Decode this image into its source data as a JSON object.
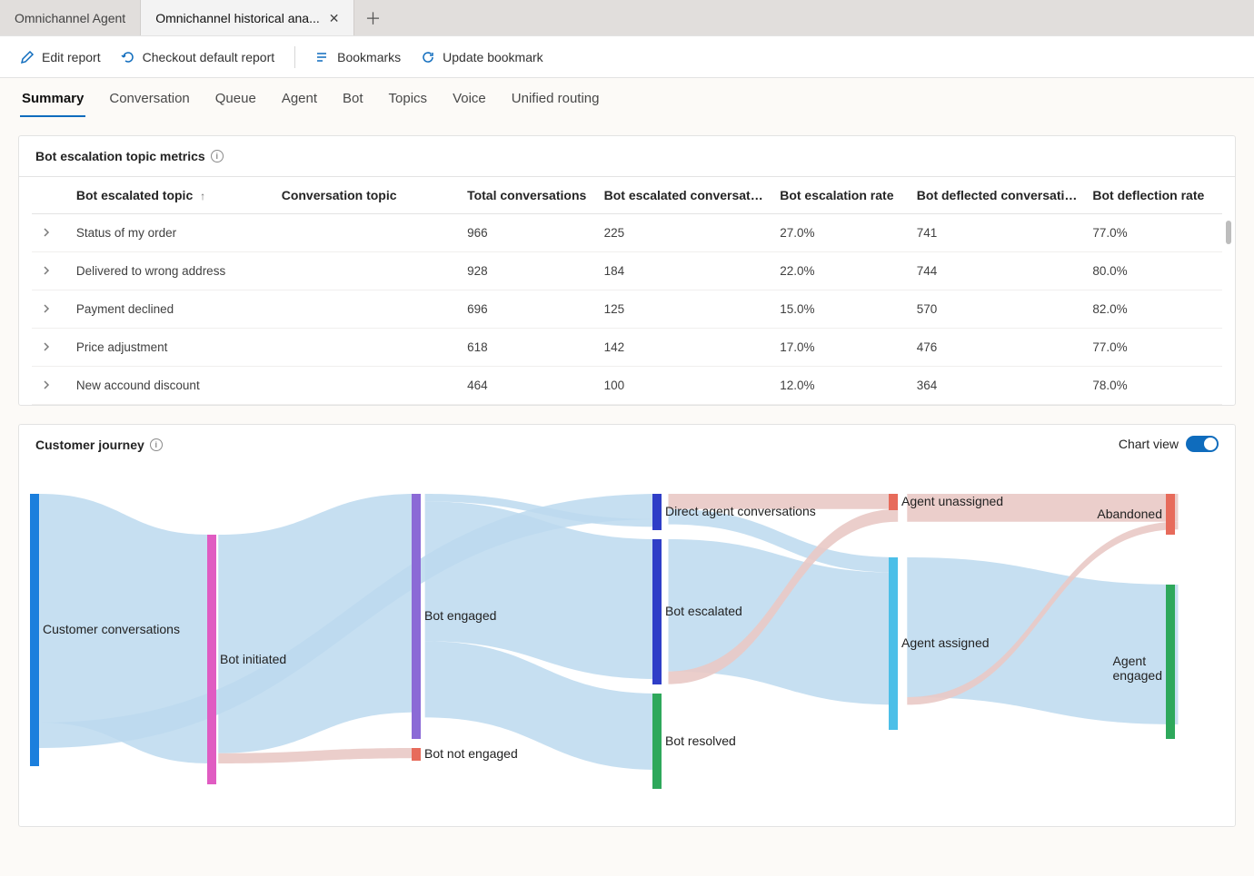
{
  "window_tabs": [
    {
      "label": "Omnichannel Agent",
      "active": false,
      "closable": false
    },
    {
      "label": "Omnichannel historical ana...",
      "active": true,
      "closable": true
    }
  ],
  "toolbar": {
    "edit": "Edit report",
    "checkout": "Checkout default report",
    "bookmarks": "Bookmarks",
    "update": "Update bookmark"
  },
  "report_tabs": [
    "Summary",
    "Conversation",
    "Queue",
    "Agent",
    "Bot",
    "Topics",
    "Voice",
    "Unified routing"
  ],
  "active_report_tab": "Summary",
  "metrics_panel": {
    "title": "Bot escalation topic metrics",
    "columns": [
      "Bot escalated topic",
      "Conversation topic",
      "Total conversations",
      "Bot escalated conversations",
      "Bot escalation rate",
      "Bot deflected conversations",
      "Bot deflection rate"
    ],
    "rows": [
      {
        "topic": "Status of my order",
        "conv": "",
        "total": "966",
        "esc": "225",
        "esc_rate": "27.0%",
        "def": "741",
        "def_rate": "77.0%"
      },
      {
        "topic": "Delivered to wrong address",
        "conv": "",
        "total": "928",
        "esc": "184",
        "esc_rate": "22.0%",
        "def": "744",
        "def_rate": "80.0%"
      },
      {
        "topic": "Payment declined",
        "conv": "",
        "total": "696",
        "esc": "125",
        "esc_rate": "15.0%",
        "def": "570",
        "def_rate": "82.0%"
      },
      {
        "topic": "Price adjustment",
        "conv": "",
        "total": "618",
        "esc": "142",
        "esc_rate": "17.0%",
        "def": "476",
        "def_rate": "77.0%"
      },
      {
        "topic": "New accound discount",
        "conv": "",
        "total": "464",
        "esc": "100",
        "esc_rate": "12.0%",
        "def": "364",
        "def_rate": "78.0%"
      }
    ]
  },
  "journey_panel": {
    "title": "Customer journey",
    "toggle_label": "Chart view",
    "toggle_on": true,
    "nodes": {
      "customer": "Customer conversations",
      "bot_initiated": "Bot initiated",
      "bot_engaged": "Bot engaged",
      "bot_not_engaged": "Bot not engaged",
      "direct_agent": "Direct agent conversations",
      "bot_escalated": "Bot escalated",
      "bot_resolved": "Bot resolved",
      "agent_unassigned": "Agent unassigned",
      "agent_assigned": "Agent assigned",
      "abandoned": "Abandoned",
      "agent_engaged": "Agent engaged"
    }
  },
  "chart_data": {
    "type": "sankey",
    "title": "Customer journey",
    "nodes": [
      {
        "id": "customer",
        "label": "Customer conversations",
        "color": "#1b7fdd",
        "col": 0,
        "value": 100
      },
      {
        "id": "bot_initiated",
        "label": "Bot initiated",
        "color": "#e05cc2",
        "col": 1,
        "value": 90
      },
      {
        "id": "bot_engaged",
        "label": "Bot engaged",
        "color": "#8b6ad6",
        "col": 2,
        "value": 88
      },
      {
        "id": "bot_not_engaged",
        "label": "Bot not engaged",
        "color": "#e76b5b",
        "col": 2,
        "value": 4
      },
      {
        "id": "direct_agent",
        "label": "Direct agent conversations",
        "color": "#2f3ec7",
        "col": 3,
        "value": 12
      },
      {
        "id": "bot_escalated",
        "label": "Bot escalated",
        "color": "#2f3ec7",
        "col": 3,
        "value": 57
      },
      {
        "id": "bot_resolved",
        "label": "Bot resolved",
        "color": "#2ea85b",
        "col": 3,
        "value": 34
      },
      {
        "id": "agent_unassigned",
        "label": "Agent unassigned",
        "color": "#e76b5b",
        "col": 4,
        "value": 8
      },
      {
        "id": "agent_assigned",
        "label": "Agent assigned",
        "color": "#4cbfe8",
        "col": 4,
        "value": 62
      },
      {
        "id": "abandoned",
        "label": "Abandoned",
        "color": "#e76b5b",
        "col": 5,
        "value": 12
      },
      {
        "id": "agent_engaged",
        "label": "Agent engaged",
        "color": "#2ea85b",
        "col": 5,
        "value": 55
      }
    ],
    "links": [
      {
        "source": "customer",
        "target": "bot_initiated",
        "value": 90,
        "color": "blue"
      },
      {
        "source": "customer",
        "target": "direct_agent",
        "value": 10,
        "color": "blue"
      },
      {
        "source": "bot_initiated",
        "target": "bot_engaged",
        "value": 86,
        "color": "blue"
      },
      {
        "source": "bot_initiated",
        "target": "bot_not_engaged",
        "value": 4,
        "color": "red"
      },
      {
        "source": "bot_engaged",
        "target": "direct_agent",
        "value": 3,
        "color": "blue"
      },
      {
        "source": "bot_engaged",
        "target": "bot_escalated",
        "value": 55,
        "color": "blue"
      },
      {
        "source": "bot_engaged",
        "target": "bot_resolved",
        "value": 30,
        "color": "blue"
      },
      {
        "source": "direct_agent",
        "target": "agent_unassigned",
        "value": 6,
        "color": "red"
      },
      {
        "source": "direct_agent",
        "target": "agent_assigned",
        "value": 6,
        "color": "blue"
      },
      {
        "source": "bot_escalated",
        "target": "agent_assigned",
        "value": 52,
        "color": "blue"
      },
      {
        "source": "bot_escalated",
        "target": "agent_unassigned",
        "value": 5,
        "color": "red"
      },
      {
        "source": "agent_unassigned",
        "target": "abandoned",
        "value": 11,
        "color": "red"
      },
      {
        "source": "agent_assigned",
        "target": "agent_engaged",
        "value": 55,
        "color": "blue"
      },
      {
        "source": "agent_assigned",
        "target": "abandoned",
        "value": 3,
        "color": "red"
      }
    ],
    "column_x": {
      "0": 0,
      "1": 195,
      "2": 420,
      "3": 685,
      "4": 945,
      "5": 1250
    }
  }
}
